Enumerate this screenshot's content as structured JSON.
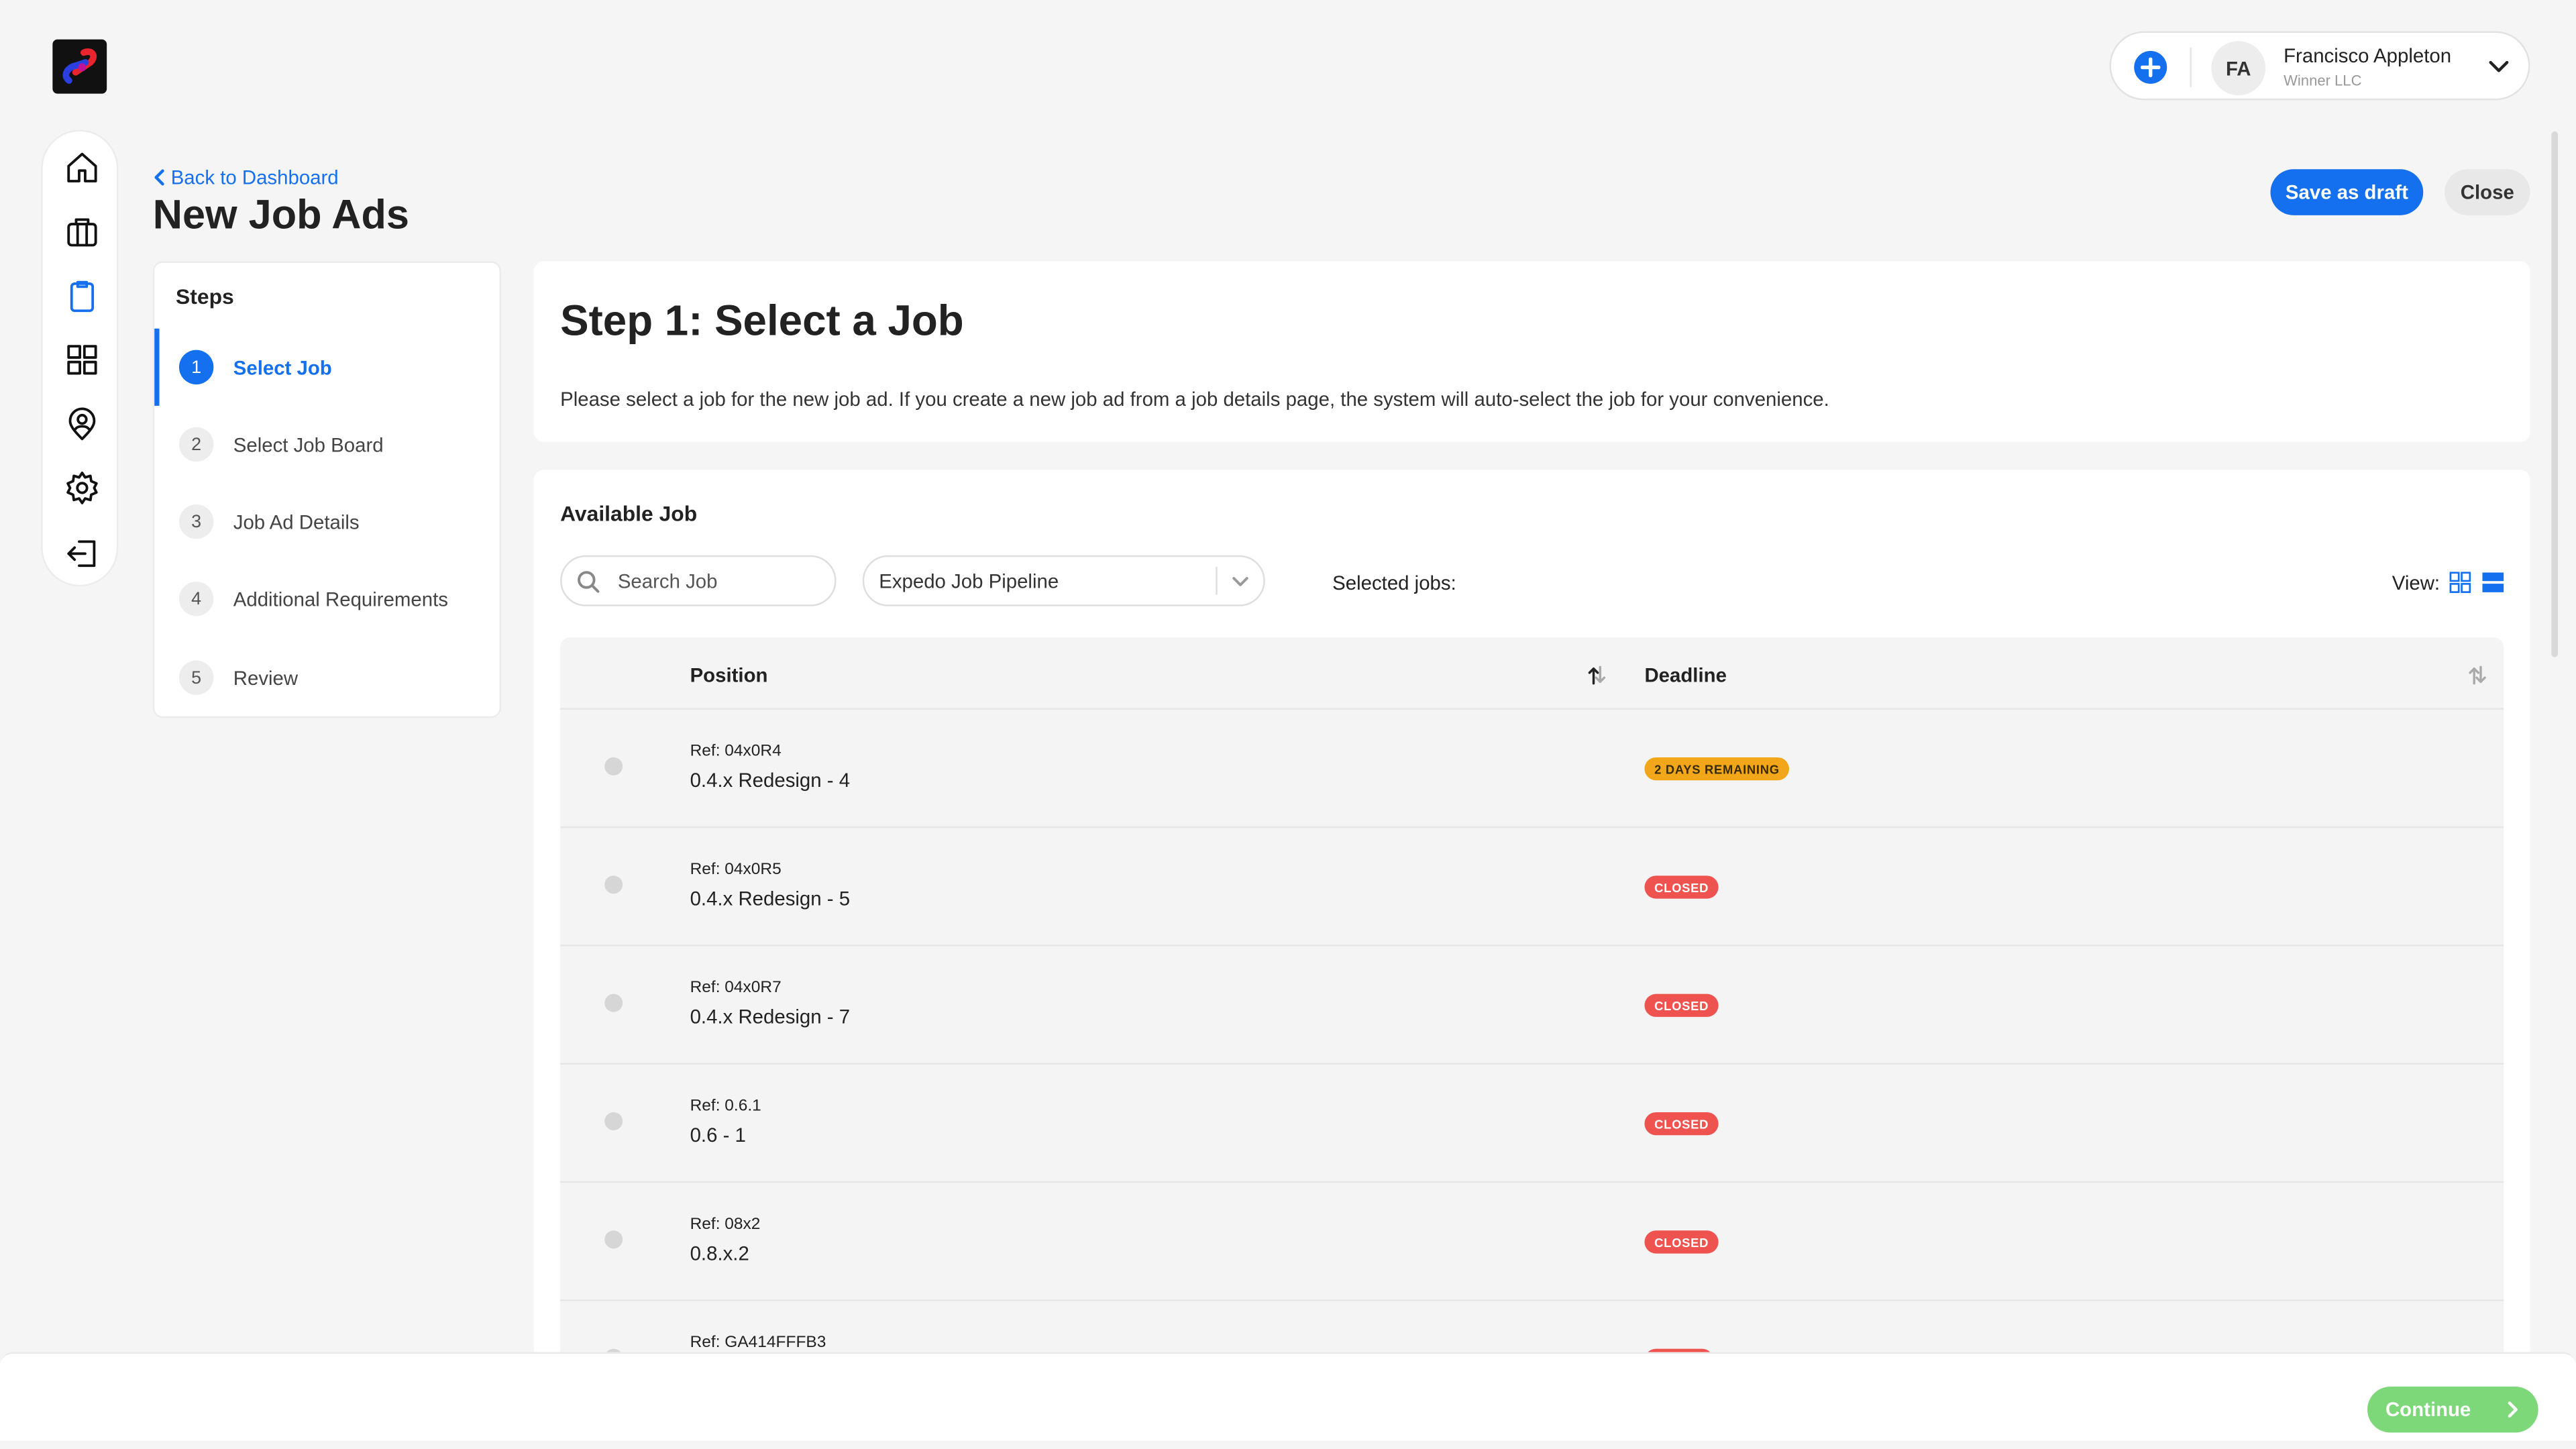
{
  "user": {
    "initials": "FA",
    "name": "Francisco Appleton",
    "org": "Winner LLC"
  },
  "header": {
    "back_label": "Back to Dashboard",
    "title": "New Job Ads",
    "save_draft_label": "Save as draft",
    "close_label": "Close"
  },
  "sidebar": {
    "items": [
      {
        "name": "home-icon",
        "active": false
      },
      {
        "name": "briefcase-icon",
        "active": false
      },
      {
        "name": "clipboard-icon",
        "active": true
      },
      {
        "name": "grid-icon",
        "active": false
      },
      {
        "name": "user-pin-icon",
        "active": false
      },
      {
        "name": "gear-icon",
        "active": false
      },
      {
        "name": "logout-icon",
        "active": false
      }
    ]
  },
  "steps": {
    "title": "Steps",
    "items": [
      {
        "number": "1",
        "label": "Select Job",
        "active": true
      },
      {
        "number": "2",
        "label": "Select Job Board",
        "active": false
      },
      {
        "number": "3",
        "label": "Job Ad Details",
        "active": false
      },
      {
        "number": "4",
        "label": "Additional Requirements",
        "active": false
      },
      {
        "number": "5",
        "label": "Review",
        "active": false
      }
    ]
  },
  "intro": {
    "title": "Step 1: Select a Job",
    "description": "Please select a job for the new job ad. If you create a new job ad from a job details page, the system will auto-select the job for your convenience."
  },
  "available": {
    "title": "Available Job",
    "search_placeholder": "Search Job",
    "pipeline_value": "Expedo Job Pipeline",
    "selected_label": "Selected jobs:",
    "view_label": "View:",
    "columns": {
      "position": "Position",
      "deadline": "Deadline"
    },
    "rows": [
      {
        "ref": "Ref: 04x0R4",
        "name": "0.4.x Redesign - 4",
        "status": "2 DAYS REMAINING",
        "status_type": "warn"
      },
      {
        "ref": "Ref: 04x0R5",
        "name": "0.4.x Redesign - 5",
        "status": "CLOSED",
        "status_type": "closed"
      },
      {
        "ref": "Ref: 04x0R7",
        "name": "0.4.x Redesign - 7",
        "status": "CLOSED",
        "status_type": "closed"
      },
      {
        "ref": "Ref: 0.6.1",
        "name": "0.6 - 1",
        "status": "CLOSED",
        "status_type": "closed"
      },
      {
        "ref": "Ref: 08x2",
        "name": "0.8.x.2",
        "status": "CLOSED",
        "status_type": "closed"
      },
      {
        "ref": "Ref: GA414FFFB3",
        "name": "",
        "status": "",
        "status_type": "closed"
      }
    ]
  },
  "footer": {
    "continue_label": "Continue"
  },
  "colors": {
    "accent": "#1570ef",
    "continue": "#7dd87a",
    "warn": "#f2a71b",
    "closed": "#ef5350"
  }
}
